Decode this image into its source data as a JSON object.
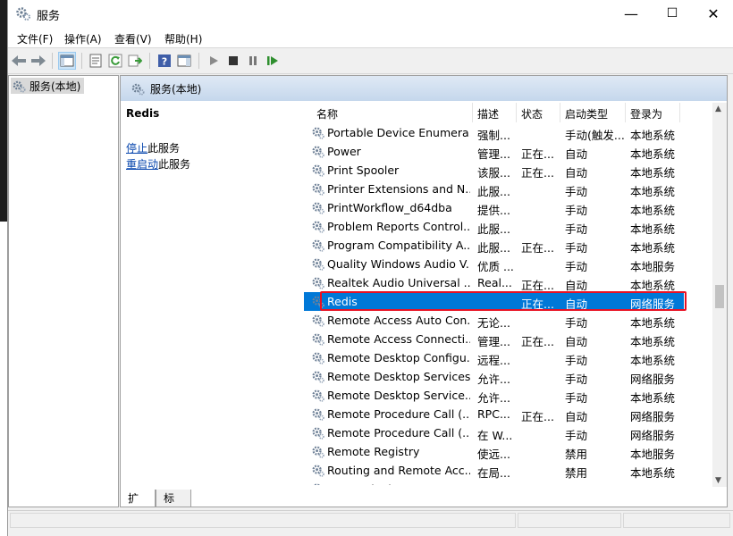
{
  "window": {
    "title": "服务"
  },
  "controls": {
    "minimize": "—",
    "maximize": "☐",
    "close": "✕"
  },
  "menu": [
    "文件(F)",
    "操作(A)",
    "查看(V)",
    "帮助(H)"
  ],
  "tree": {
    "item": "服务(本地)"
  },
  "panel": {
    "header": "服务(本地)",
    "selected_name": "Redis",
    "stop_link": "停止",
    "stop_suffix": "此服务",
    "restart_link": "重启动",
    "restart_suffix": "此服务"
  },
  "columns": {
    "name": "名称",
    "desc": "描述",
    "status": "状态",
    "startup": "启动类型",
    "logon": "登录为"
  },
  "rows": [
    {
      "name": "Portable Device Enumera...",
      "desc": "强制...",
      "status": "",
      "startup": "手动(触发...",
      "logon": "本地系统"
    },
    {
      "name": "Power",
      "desc": "管理...",
      "status": "正在...",
      "startup": "自动",
      "logon": "本地系统"
    },
    {
      "name": "Print Spooler",
      "desc": "该服...",
      "status": "正在...",
      "startup": "自动",
      "logon": "本地系统"
    },
    {
      "name": "Printer Extensions and N...",
      "desc": "此服...",
      "status": "",
      "startup": "手动",
      "logon": "本地系统"
    },
    {
      "name": "PrintWorkflow_d64dba",
      "desc": "提供...",
      "status": "",
      "startup": "手动",
      "logon": "本地系统"
    },
    {
      "name": "Problem Reports Control...",
      "desc": "此服...",
      "status": "",
      "startup": "手动",
      "logon": "本地系统"
    },
    {
      "name": "Program Compatibility A...",
      "desc": "此服...",
      "status": "正在...",
      "startup": "手动",
      "logon": "本地系统"
    },
    {
      "name": "Quality Windows Audio V...",
      "desc": "优质 ...",
      "status": "",
      "startup": "手动",
      "logon": "本地服务"
    },
    {
      "name": "Realtek Audio Universal ...",
      "desc": "Real...",
      "status": "正在...",
      "startup": "自动",
      "logon": "本地系统"
    },
    {
      "name": "Redis",
      "desc": "",
      "status": "正在...",
      "startup": "自动",
      "logon": "网络服务",
      "selected": true
    },
    {
      "name": "Remote Access Auto Con...",
      "desc": "无论...",
      "status": "",
      "startup": "手动",
      "logon": "本地系统"
    },
    {
      "name": "Remote Access Connecti...",
      "desc": "管理...",
      "status": "正在...",
      "startup": "自动",
      "logon": "本地系统"
    },
    {
      "name": "Remote Desktop Configu...",
      "desc": "远程...",
      "status": "",
      "startup": "手动",
      "logon": "本地系统"
    },
    {
      "name": "Remote Desktop Services",
      "desc": "允许...",
      "status": "",
      "startup": "手动",
      "logon": "网络服务"
    },
    {
      "name": "Remote Desktop Service...",
      "desc": "允许...",
      "status": "",
      "startup": "手动",
      "logon": "本地系统"
    },
    {
      "name": "Remote Procedure Call (...",
      "desc": "RPC...",
      "status": "正在...",
      "startup": "自动",
      "logon": "网络服务"
    },
    {
      "name": "Remote Procedure Call (...",
      "desc": "在 W...",
      "status": "",
      "startup": "手动",
      "logon": "网络服务"
    },
    {
      "name": "Remote Registry",
      "desc": "使远...",
      "status": "",
      "startup": "禁用",
      "logon": "本地服务"
    },
    {
      "name": "Routing and Remote Acc...",
      "desc": "在局...",
      "status": "",
      "startup": "禁用",
      "logon": "本地系统"
    },
    {
      "name": "RPC Endpoint Mapper",
      "desc": "解析...",
      "status": "正在...",
      "startup": "自动",
      "logon": "网络服务"
    }
  ],
  "tabs": [
    "扩展",
    "标准"
  ],
  "colors": {
    "selection": "#0078d7",
    "highlight_box": "#e81123",
    "link": "#0645ad"
  }
}
